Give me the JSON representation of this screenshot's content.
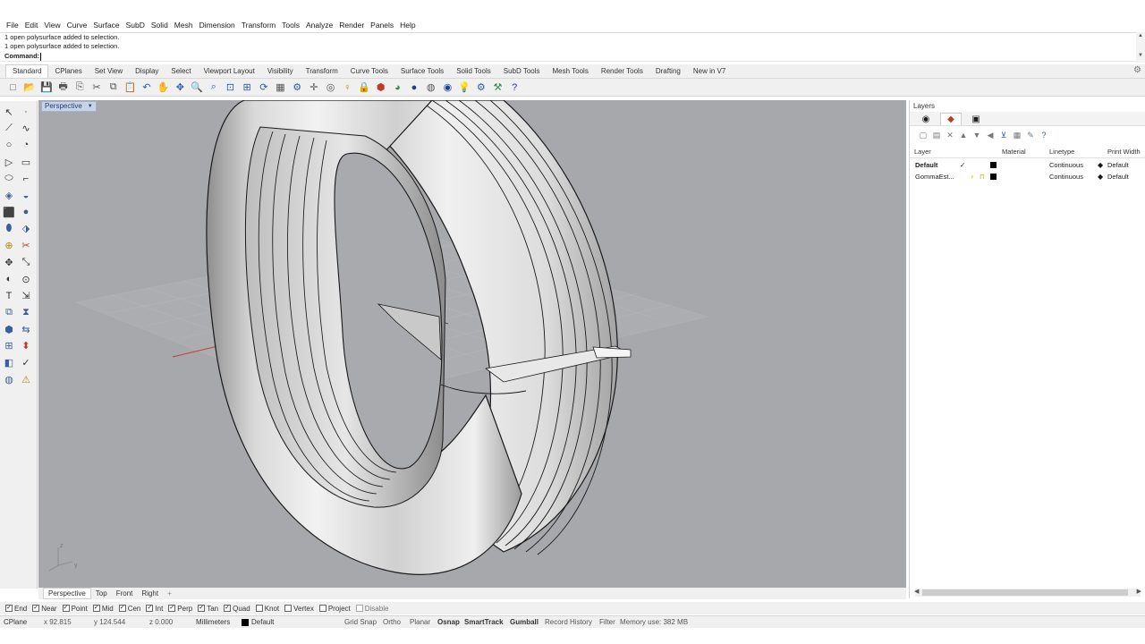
{
  "menu": [
    "File",
    "Edit",
    "View",
    "Curve",
    "Surface",
    "SubD",
    "Solid",
    "Mesh",
    "Dimension",
    "Transform",
    "Tools",
    "Analyze",
    "Render",
    "Panels",
    "Help"
  ],
  "command": {
    "history": [
      "1 open polysurface added to selection.",
      "1 open polysurface added to selection."
    ],
    "prompt": "Command:"
  },
  "tabs": [
    "Standard",
    "CPlanes",
    "Set View",
    "Display",
    "Select",
    "Viewport Layout",
    "Visibility",
    "Transform",
    "Curve Tools",
    "Surface Tools",
    "Solid Tools",
    "SubD Tools",
    "Mesh Tools",
    "Render Tools",
    "Drafting",
    "New in V7"
  ],
  "active_tab": "Standard",
  "toolbar_icons": [
    "new-icon",
    "open-icon",
    "save-icon",
    "print-icon",
    "import-icon",
    "cut-icon",
    "copy-icon",
    "paste-icon",
    "undo-icon",
    "pan-icon",
    "move-icon",
    "zoom-in-icon",
    "zoom-window-icon",
    "zoom-extents-icon",
    "zoom-selected-icon",
    "rotate-view-icon",
    "grid-icon",
    "tools-icon",
    "point-icon",
    "cplane-icon",
    "light-icon",
    "lock-icon",
    "render-icon",
    "color-wheel-icon",
    "sphere-icon",
    "material-icon",
    "render-sphere-icon",
    "light-bulb-icon",
    "options-icon",
    "tool-settings-icon",
    "help-icon"
  ],
  "viewport": {
    "label": "Perspective",
    "background": "#a6a8ab",
    "axis_labels": {
      "x": "x",
      "y": "y",
      "z": "z"
    }
  },
  "viewport_tabs": [
    "Perspective",
    "Top",
    "Front",
    "Right"
  ],
  "panel": {
    "title": "Layers",
    "columns": [
      "Layer",
      "Material",
      "Linetype",
      "Print Width"
    ],
    "layers": [
      {
        "name": "Default",
        "current": true,
        "linetype": "Continuous",
        "print_width": "Default",
        "color": "#000000"
      },
      {
        "name": "GommaEst...",
        "current": false,
        "linetype": "Continuous",
        "print_width": "Default",
        "color": "#000000"
      }
    ]
  },
  "osnaps": [
    {
      "label": "End",
      "checked": true
    },
    {
      "label": "Near",
      "checked": true
    },
    {
      "label": "Point",
      "checked": true
    },
    {
      "label": "Mid",
      "checked": true
    },
    {
      "label": "Cen",
      "checked": true
    },
    {
      "label": "Int",
      "checked": true
    },
    {
      "label": "Perp",
      "checked": true
    },
    {
      "label": "Tan",
      "checked": true
    },
    {
      "label": "Quad",
      "checked": true
    },
    {
      "label": "Knot",
      "checked": false
    },
    {
      "label": "Vertex",
      "checked": false
    },
    {
      "label": "Project",
      "checked": false
    },
    {
      "label": "Disable",
      "checked": false
    }
  ],
  "status": {
    "cplane": "CPlane",
    "x": "x 92.815",
    "y": "y 124.544",
    "z": "z 0.000",
    "units": "Millimeters",
    "layer": "Default",
    "grid_snap": "Grid Snap",
    "ortho": "Ortho",
    "planar": "Planar",
    "osnap": "Osnap",
    "smarttrack": "SmartTrack",
    "gumball": "Gumball",
    "record_history": "Record History",
    "filter": "Filter",
    "memory": "Memory use: 382 MB"
  }
}
